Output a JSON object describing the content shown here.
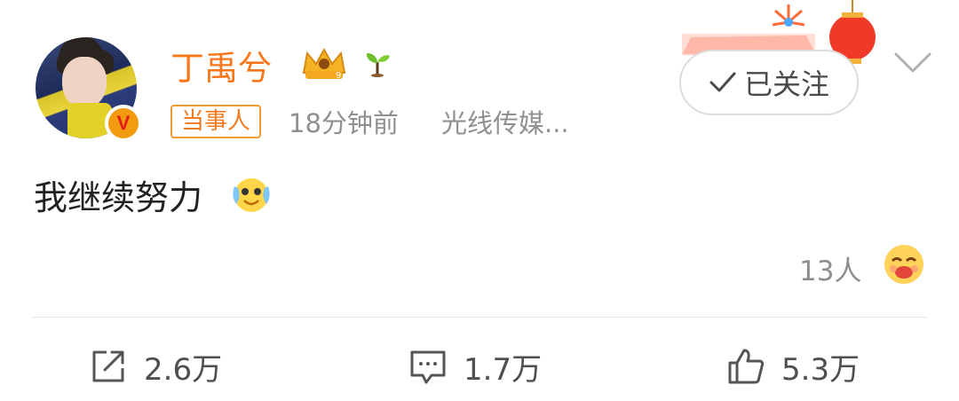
{
  "post": {
    "username": "丁禹兮",
    "tag": "当事人",
    "time": "18分钟前",
    "source": "光线传媒...",
    "text": "我继续努力",
    "inline_emoji": "crying-laugh-emoji",
    "reaction_count": "13人",
    "reaction_emoji": "love-kiss-emoji"
  },
  "follow": {
    "label": "已关注"
  },
  "actions": {
    "repost_count": "2.6万",
    "comment_count": "1.7万",
    "like_count": "5.3万"
  },
  "colors": {
    "username": "#f7771a",
    "tag": "#f37b1d",
    "meta": "#909090",
    "text": "#222222",
    "badge": "#f29a10"
  },
  "icons": {
    "verified": "verified-v-icon",
    "vip": "crown-icon",
    "sprout": "sprout-icon",
    "check": "check-icon",
    "more": "chevron-down-icon",
    "repost": "share-icon",
    "comment": "comment-icon",
    "like": "thumbs-up-icon"
  },
  "verified_badge": "V"
}
